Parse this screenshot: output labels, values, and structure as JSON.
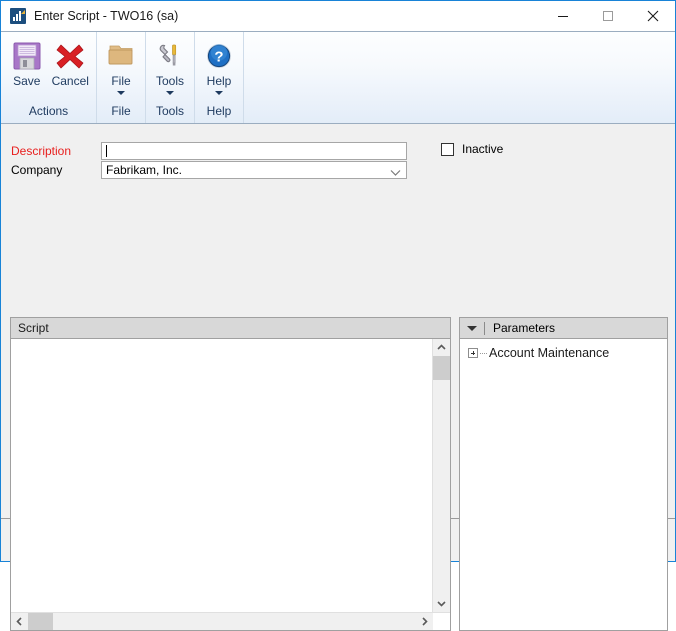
{
  "window": {
    "title": "Enter Script  -  TWO16 (sa)",
    "app_icon": "chart-icon",
    "controls": {
      "minimize": "minimize-icon",
      "maximize": "maximize-icon",
      "close": "close-icon"
    },
    "accent_color": "#1883d7"
  },
  "ribbon": {
    "groups": [
      {
        "name": "actions",
        "label": "Actions",
        "buttons": [
          {
            "id": "save",
            "label": "Save",
            "icon": "save-floppy-icon",
            "has_menu": false
          },
          {
            "id": "cancel",
            "label": "Cancel",
            "icon": "cancel-x-icon",
            "has_menu": false
          }
        ]
      },
      {
        "name": "file",
        "label": "File",
        "buttons": [
          {
            "id": "file",
            "label": "File",
            "icon": "folder-icon",
            "has_menu": true
          }
        ]
      },
      {
        "name": "tools",
        "label": "Tools",
        "buttons": [
          {
            "id": "tools",
            "label": "Tools",
            "icon": "wrench-screwdriver-icon",
            "has_menu": true
          }
        ]
      },
      {
        "name": "help",
        "label": "Help",
        "buttons": [
          {
            "id": "help",
            "label": "Help",
            "icon": "help-question-icon",
            "has_menu": true
          }
        ]
      }
    ]
  },
  "form": {
    "description": {
      "label": "Description",
      "value": "",
      "required": true,
      "label_color": "#e8201f"
    },
    "company": {
      "label": "Company",
      "value": "Fabrikam, Inc.",
      "options": [
        "Fabrikam, Inc."
      ]
    },
    "inactive": {
      "label": "Inactive",
      "checked": false
    }
  },
  "script_panel": {
    "header": "Script",
    "content": "",
    "vertical_scrollbar": {
      "up": "chevron-up-icon",
      "down": "chevron-down-icon"
    },
    "horizontal_scrollbar": {
      "left": "chevron-left-icon",
      "right": "chevron-right-icon"
    }
  },
  "parameters_panel": {
    "header": "Parameters",
    "collapse_icon": "triangle-down-icon",
    "items": [
      {
        "label": "Account Maintenance",
        "expanded": false,
        "expander": "plus-box-icon"
      }
    ]
  }
}
